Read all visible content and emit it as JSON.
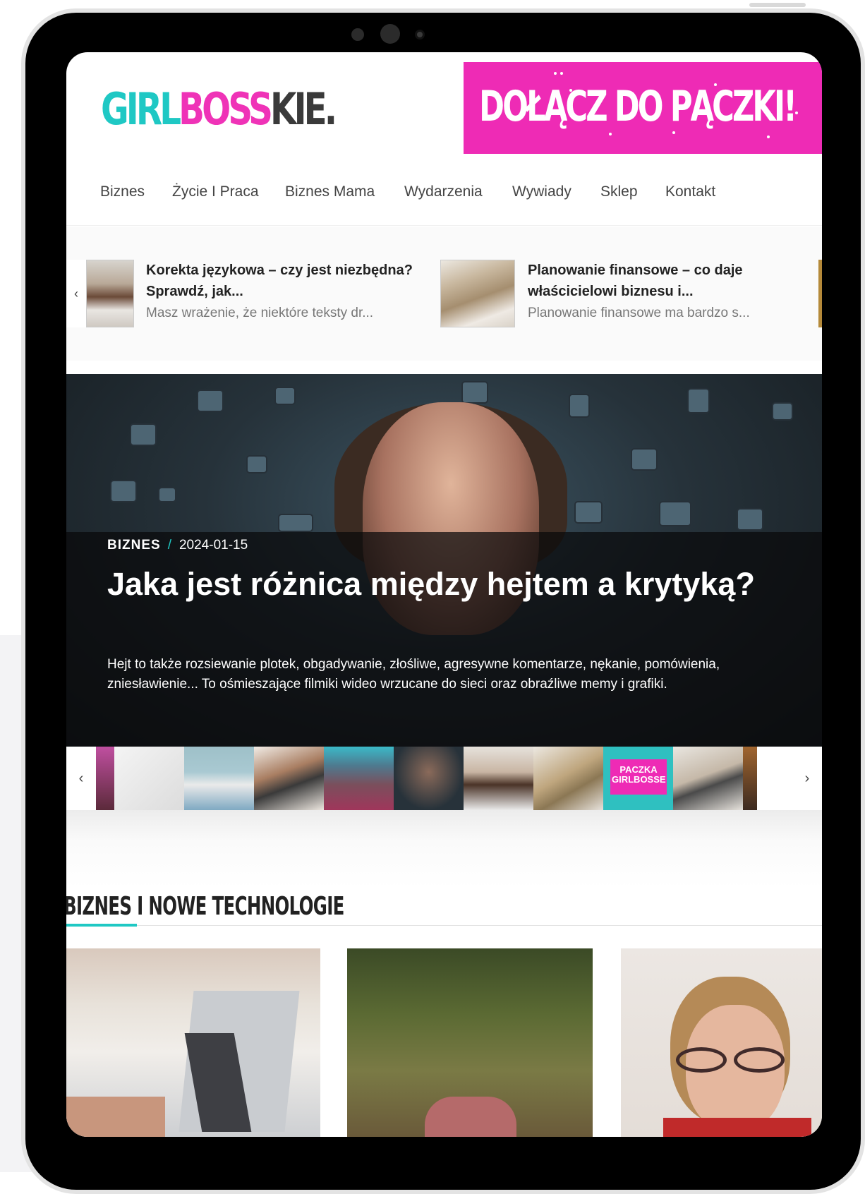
{
  "logo": {
    "part1": "GIRL",
    "part2": "BOSS",
    "part3": "KIE."
  },
  "banner": {
    "text": "DOŁĄCZ DO PĄCZKI!"
  },
  "nav": {
    "items": [
      "Biznes",
      "Życie I Praca",
      "Biznes Mama",
      "Wydarzenia",
      "Wywiady",
      "Sklep",
      "Kontakt"
    ]
  },
  "ticker": {
    "prev_icon": "‹",
    "items": [
      {
        "title": "Korekta językowa – czy jest niezbędna? Sprawdź, jak...",
        "excerpt": "Masz wrażenie, że niektóre teksty dr..."
      },
      {
        "title": "Planowanie finansowe – co daje właścicielowi biznesu i...",
        "excerpt": "Planowanie finansowe ma bardzo s..."
      }
    ]
  },
  "hero": {
    "category": "BIZNES",
    "separator": "/",
    "date": "2024-01-15",
    "title": "Jaka jest różnica między hejtem a krytyką?",
    "excerpt": "Hejt to także rozsiewanie plotek, obgadywanie, złośliwe, agresywne komentarze, nękanie, pomówienia, zniesławienie... To ośmieszające filmiki wideo wrzucane do sieci oraz obraźliwe memy i grafiki."
  },
  "thumbs": {
    "prev_icon": "‹",
    "next_icon": "›",
    "promo_text": "PACZKA GIRLBOSSE"
  },
  "section": {
    "title": "BIZNES I NOWE TECHNOLOGIE"
  },
  "colors": {
    "teal": "#1fc8c4",
    "pink": "#ee2bb5",
    "dark": "#3a3a3a"
  }
}
